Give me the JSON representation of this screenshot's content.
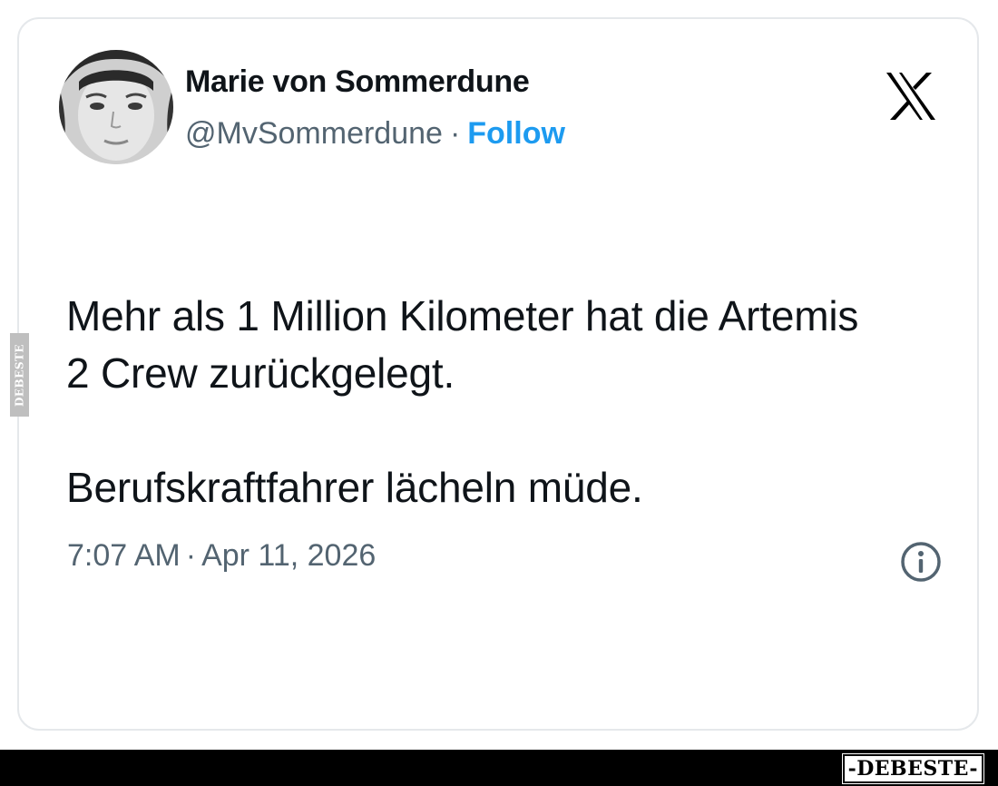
{
  "tweet": {
    "author": {
      "display_name": "Marie von Sommerdune",
      "handle": "@MvSommerdune",
      "separator": "·",
      "follow_label": "Follow",
      "avatar_icon": "profile-photo"
    },
    "platform_icon": "x-logo",
    "text": {
      "paragraph1": "Mehr als 1 Million Kilometer hat die Artemis 2 Crew zurückgelegt.",
      "paragraph2": "Berufskraftfahrer lächeln müde."
    },
    "time": "7:07 AM",
    "date_separator": "·",
    "date": "Apr 11, 2026",
    "info_icon": "info-icon"
  },
  "watermark": {
    "side_text": "DEBESTE",
    "brand_text": "-DEBESTE-"
  },
  "colors": {
    "accent": "#1d9bf0",
    "text": "#0f1419",
    "secondary": "#536471",
    "border": "#e5e8eb"
  }
}
